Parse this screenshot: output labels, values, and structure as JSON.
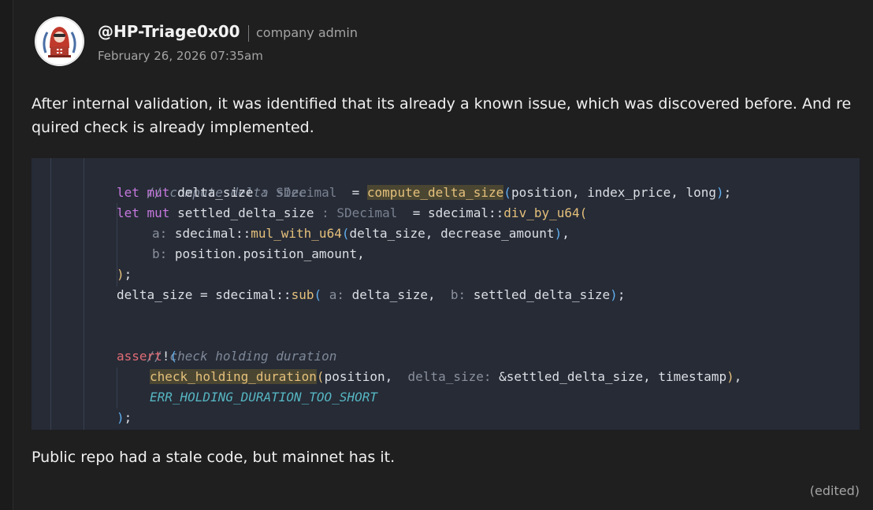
{
  "post": {
    "username": "@HP-Triage0x00",
    "role": "company admin",
    "timestamp": "February 26, 2026 07:35am",
    "body": "After internal validation, it was identified that its already a known issue, which was discovered before. And required check is already implemented.",
    "footer": "Public repo had a stale code, but mainnet has it.",
    "edited_label": "(edited)"
  },
  "code": {
    "comment1": "// compute delta size",
    "l2_let": "let mut",
    "l2_var": " delta_size",
    "l2_hint": " : SDecimal",
    "l2_eq": "  = ",
    "l2_fn": "compute_delta_size",
    "l2_open": "(",
    "l2_args": "position, index_price, long",
    "l2_close": ")",
    "l2_semi": ";",
    "l3_let": "let mut",
    "l3_var": " settled_delta_size",
    "l3_hint": " : SDecimal",
    "l3_eq": "  = sdecimal::",
    "l3_fn": "div_by_u64",
    "l3_open": "(",
    "l4_hint": "a: ",
    "l4_ns": "sdecimal::",
    "l4_fn": "mul_with_u64",
    "l4_open": "(",
    "l4_args": "delta_size, decrease_amount",
    "l4_close": ")",
    "l4_comma": ",",
    "l5_hint": "b: ",
    "l5_text": "position.position_amount,",
    "l6_close": ")",
    "l6_semi": ";",
    "l7_text": "delta_size = sdecimal::",
    "l7_fn": "sub",
    "l7_open": "(",
    "l7_hint_a": " a: ",
    "l7_arg_a": "delta_size,  ",
    "l7_hint_b": "b: ",
    "l7_arg_b": "settled_delta_size",
    "l7_close": ")",
    "l7_semi": ";",
    "comment2": "// check holding duration",
    "l9_macro": "assert",
    "l9_bang": "!",
    "l9_open": "(",
    "l10_fn": "check_holding_duration",
    "l10_open": "(",
    "l10_arg1": "position,  ",
    "l10_hint": "delta_size: ",
    "l10_args": "&settled_delta_size, timestamp",
    "l10_close": ")",
    "l10_comma": ",",
    "l11_const": "ERR_HOLDING_DURATION_TOO_SHORT",
    "l12_close": ")",
    "l12_semi": ";"
  }
}
